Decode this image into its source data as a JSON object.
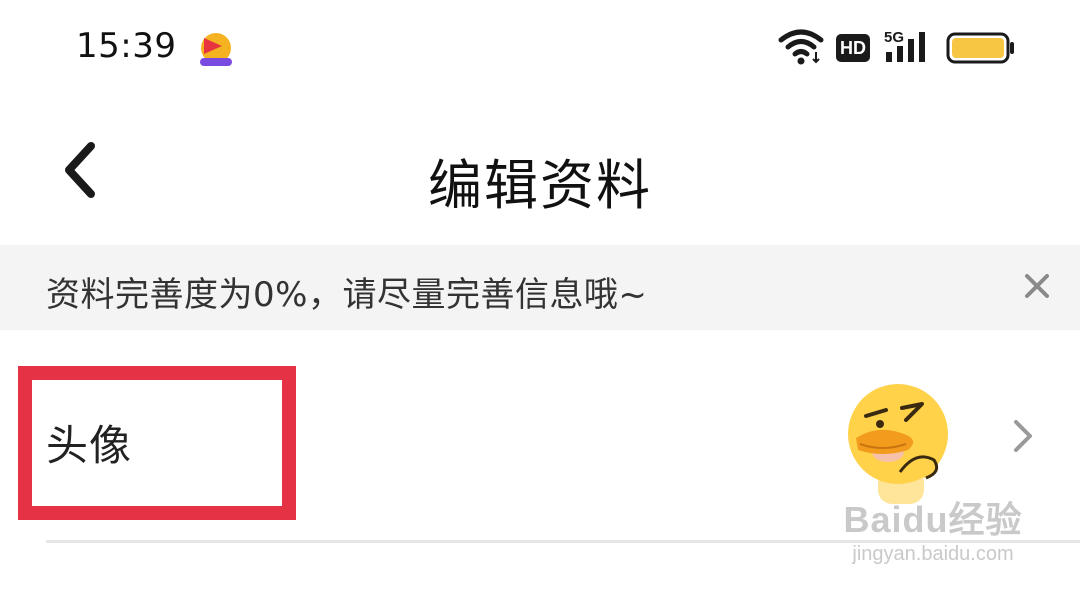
{
  "status_bar": {
    "time": "15:39",
    "network_badge": "HD",
    "network_type": "5G",
    "icons": [
      "app-icon",
      "wifi-icon",
      "hd-icon",
      "signal-5g-icon",
      "battery-icon"
    ]
  },
  "header": {
    "title": "编辑资料",
    "back_icon": "chevron-left-icon"
  },
  "notice": {
    "text": "资料完善度为0%，请尽量完善信息哦~",
    "completion_percent": 0,
    "close_icon": "close-icon"
  },
  "profile_rows": [
    {
      "label": "头像",
      "value_icon": "avatar-duck-icon",
      "action_icon": "chevron-right-icon"
    }
  ],
  "watermark": {
    "main": "Baidu经验",
    "sub": "jingyan.baidu.com"
  },
  "colors": {
    "highlight": "#e53345",
    "notice_bg": "#f4f4f5",
    "battery": "#f7c744",
    "avatar_yellow": "#ffd24a",
    "beak": "#f29b1d"
  }
}
